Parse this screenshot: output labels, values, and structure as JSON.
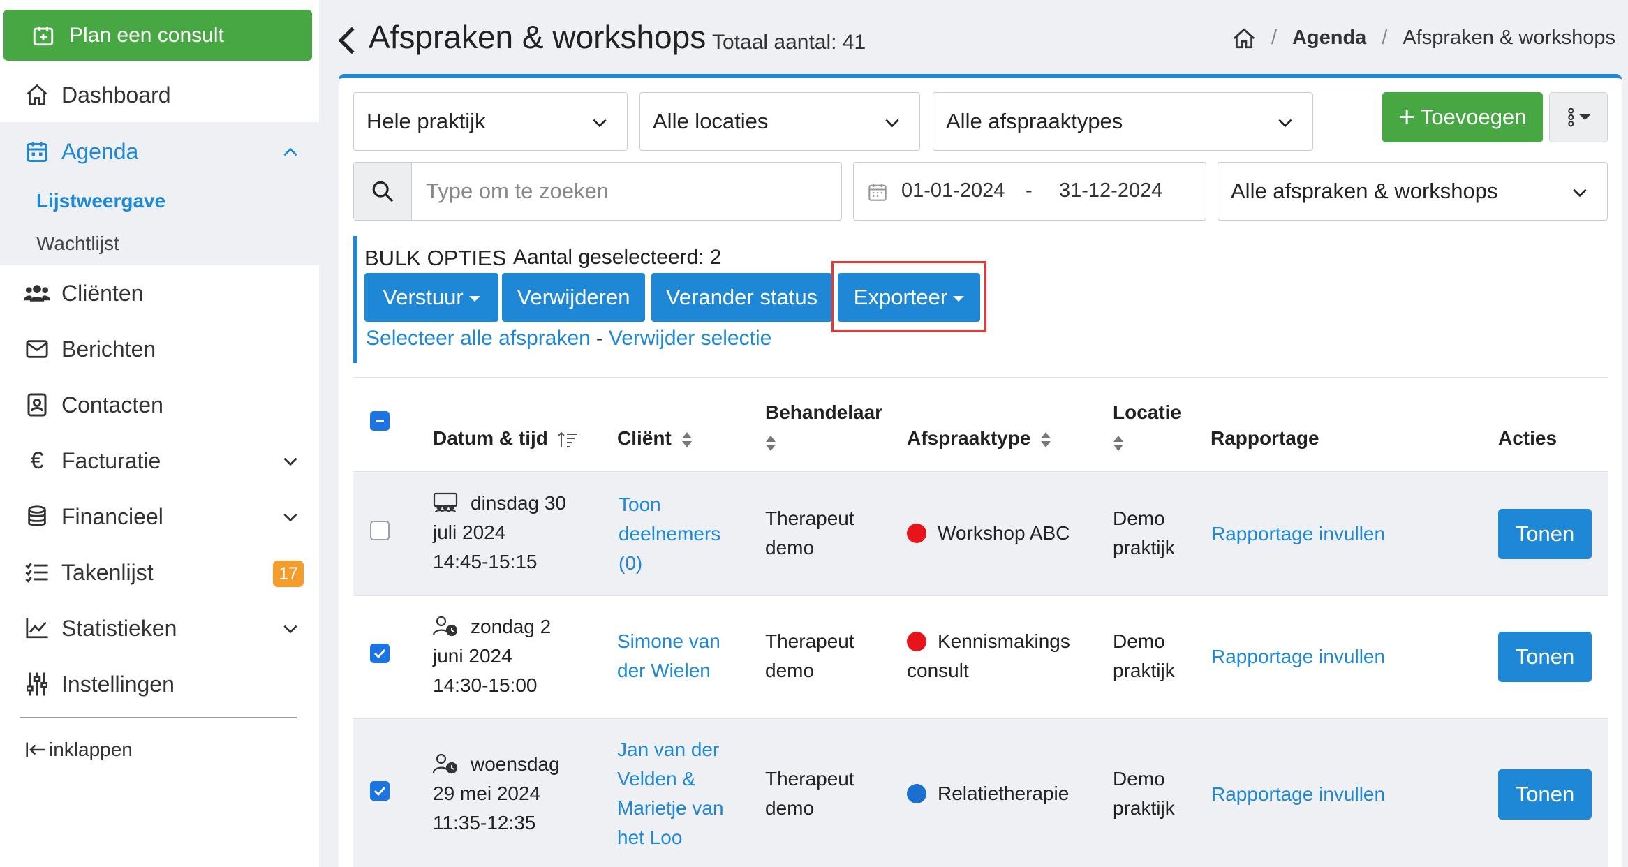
{
  "sidebar": {
    "plan_button": "Plan een consult",
    "items": {
      "dashboard": "Dashboard",
      "agenda": "Agenda",
      "lijstweergave": "Lijstweergave",
      "wachtlijst": "Wachtlijst",
      "clienten": "Cliënten",
      "berichten": "Berichten",
      "contacten": "Contacten",
      "facturatie": "Facturatie",
      "financieel": "Financieel",
      "takenlijst": "Takenlijst",
      "takenlijst_badge": "17",
      "statistieken": "Statistieken",
      "instellingen": "Instellingen"
    },
    "collapse_label": "inklappen"
  },
  "header": {
    "title": "Afspraken & workshops",
    "total": "Totaal aantal: 41",
    "breadcrumb": {
      "current_section": "Agenda",
      "current_page": "Afspraken & workshops"
    }
  },
  "filters": {
    "praktijk": "Hele praktijk",
    "locaties": "Alle locaties",
    "afspraaktypes": "Alle afspraaktypes",
    "add_button": "Toevoegen",
    "search_placeholder": "Type om te zoeken",
    "date_from": "01-01-2024",
    "date_sep": "-",
    "date_to": "31-12-2024",
    "scope": "Alle afspraken & workshops"
  },
  "bulk": {
    "title": "BULK OPTIES",
    "count": "Aantal geselecteerd: 2",
    "send": "Verstuur",
    "delete": "Verwijderen",
    "status": "Verander status",
    "export": "Exporteer",
    "select_all": "Selecteer alle afspraken",
    "separator": "-",
    "clear": "Verwijder selectie"
  },
  "table": {
    "headers": {
      "datum": "Datum & tijd",
      "client": "Cliënt",
      "behandelaar": "Behandelaar",
      "type": "Afspraaktype",
      "locatie": "Locatie",
      "rapportage": "Rapportage",
      "acties": "Acties"
    },
    "rows": [
      {
        "date_l1": "dinsdag 30",
        "date_l2": "juli 2024",
        "time": "14:45-15:15",
        "client_l1": "Toon",
        "client_l2": "deelnemers",
        "client_l3": "(0)",
        "client_l4": "",
        "therapist_l1": "Therapeut",
        "therapist_l2": "demo",
        "type_l1": "Workshop ABC",
        "type_l2": "",
        "type_color": "#e8141c",
        "loc_l1": "Demo",
        "loc_l2": "praktijk",
        "report": "Rapportage invullen",
        "action": "Tonen",
        "checked": false
      },
      {
        "date_l1": "zondag 2",
        "date_l2": "juni 2024",
        "time": "14:30-15:00",
        "client_l1": "Simone van",
        "client_l2": "der Wielen",
        "client_l3": "",
        "client_l4": "",
        "therapist_l1": "Therapeut",
        "therapist_l2": "demo",
        "type_l1": "Kennismakings",
        "type_l2": "consult",
        "type_color": "#e8141c",
        "loc_l1": "Demo",
        "loc_l2": "praktijk",
        "report": "Rapportage invullen",
        "action": "Tonen",
        "checked": true
      },
      {
        "date_l1": "woensdag",
        "date_l2": "29 mei 2024",
        "time": "11:35-12:35",
        "client_l1": "Jan van der",
        "client_l2": "Velden &",
        "client_l3": "Marietje van",
        "client_l4": "het Loo",
        "therapist_l1": "Therapeut",
        "therapist_l2": "demo",
        "type_l1": "Relatietherapie",
        "type_l2": "",
        "type_color": "#1a6fd1",
        "loc_l1": "Demo",
        "loc_l2": "praktijk",
        "report": "Rapportage invullen",
        "action": "Tonen",
        "checked": true
      }
    ]
  },
  "colors": {
    "primary": "#1e88d6",
    "success": "#46a743",
    "badge": "#f59d2a",
    "highlight": "#e53935"
  }
}
